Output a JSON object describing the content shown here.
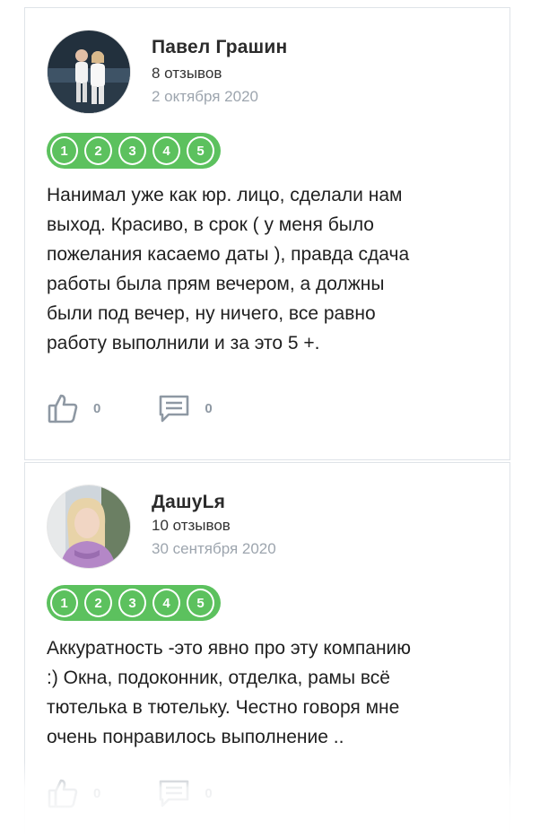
{
  "reviews": [
    {
      "author": "Павел Грашин",
      "review_count": "8 отзывов",
      "date": "2 октября 2020",
      "rating_steps": [
        "1",
        "2",
        "3",
        "4",
        "5"
      ],
      "text": "Нанимал уже как юр. лицо, сделали нам\nвыход. Красиво, в срок ( у меня было\nпожелания касаемо даты ), правда сдача\nработы была прям вечером, а должны\nбыли под вечер, ну ничего, все равно\nработу выполнили и за это 5 +.",
      "likes": "0",
      "comments": "0"
    },
    {
      "author": "ДашуLя",
      "review_count": "10 отзывов",
      "date": "30 сентября 2020",
      "rating_steps": [
        "1",
        "2",
        "3",
        "4",
        "5"
      ],
      "text": "Аккуратность -это явно про эту компанию\n:) Окна, подоконник, отделка, рамы всё\nтютелька в тютельку. Честно говоря мне\nочень понравилось выполнение ..",
      "likes": "0",
      "comments": "0"
    }
  ],
  "icons": {
    "like": "thumbs-up-icon",
    "comment": "comment-icon"
  },
  "colors": {
    "rating_green": "#5cc15e",
    "date_gray": "#9da5ae",
    "action_gray": "#8e98a3"
  }
}
